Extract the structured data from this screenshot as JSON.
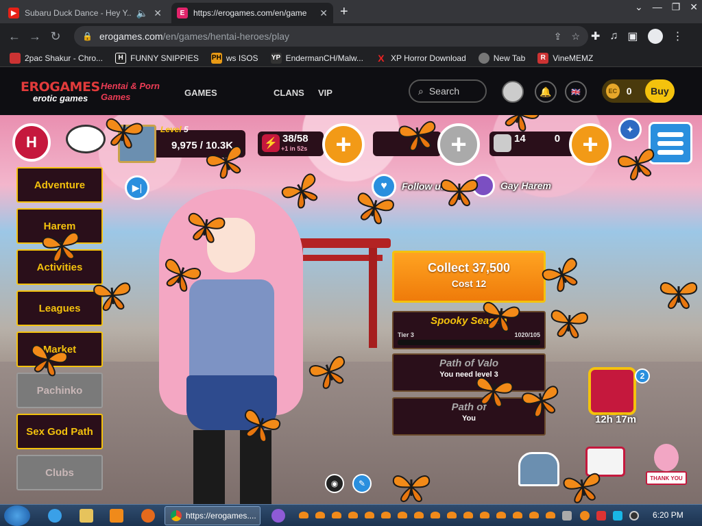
{
  "browser": {
    "tabs": [
      {
        "title": "Subaru Duck Dance - Hey Y...",
        "favicon": "youtube-icon",
        "active": false
      },
      {
        "title": "https://erogames.com/en/game",
        "favicon": "erogames-icon",
        "active": true
      }
    ],
    "url_host": "erogames.com",
    "url_path": "/en/games/hentai-heroes/play",
    "bookmarks": [
      {
        "label": "2pac Shakur - Chro...",
        "icon": "bookmark-icon",
        "color": "#c33"
      },
      {
        "label": "FUNNY SNIPPIES",
        "icon": "h-icon",
        "color": "#222"
      },
      {
        "label": "ws ISOS",
        "icon": "ph-icon",
        "color": "#e89a16"
      },
      {
        "label": "EndermanCH/Malw...",
        "icon": "yp-icon",
        "color": "#333"
      },
      {
        "label": "XP Horror Download",
        "icon": "x-icon",
        "color": "#d22"
      },
      {
        "label": "New Tab",
        "icon": "globe-icon",
        "color": "#777"
      },
      {
        "label": "VineMEMZ",
        "icon": "r-icon",
        "color": "#c33"
      }
    ]
  },
  "site": {
    "logo_top": "EROGAMES",
    "logo_bottom": "erotic games",
    "tagline": "Hentai & Porn Games",
    "nav": [
      "GAMES",
      "CLANS",
      "VIP"
    ],
    "search_label": "Search",
    "ec_balance": "0",
    "ec_badge": "EC",
    "buy_label": "Buy"
  },
  "game": {
    "level_label": "Level",
    "level_value": "5",
    "xp": "9,975 / 10.3K",
    "energy": "38/58",
    "energy_timer": "+1 in 52s",
    "currency_value": "14",
    "currency_value_tail": "0",
    "sidebar": [
      "Adventure",
      "Harem",
      "Activities",
      "Leagues",
      "Market",
      "Pachinko",
      "Sex God Path",
      "Clubs"
    ],
    "follow_label": "Follow us",
    "gay_harem_label": "Gay Harem",
    "collect_title": "Collect 37,500",
    "collect_cost": "Cost 12",
    "events": [
      {
        "title": "Spooky Season",
        "tier": "Tier 3",
        "progress": "1020/105",
        "dim": false
      },
      {
        "title": "Path of Valo",
        "subtitle": "You need level 3",
        "dim": true
      },
      {
        "title": "Path of",
        "subtitle": "You",
        "dim": true
      }
    ],
    "chest_count": "2",
    "chest_timer": "12h 17m",
    "thank_you": "THANK YOU"
  },
  "taskbar": {
    "chrome_label": "https://erogames....",
    "time": "6:20 PM"
  },
  "colors": {
    "brand_red": "#e23b3b",
    "gold": "#f4c20d",
    "orange": "#f29a17",
    "blue": "#2a8fde",
    "dark_panel": "#2a0f1a"
  }
}
